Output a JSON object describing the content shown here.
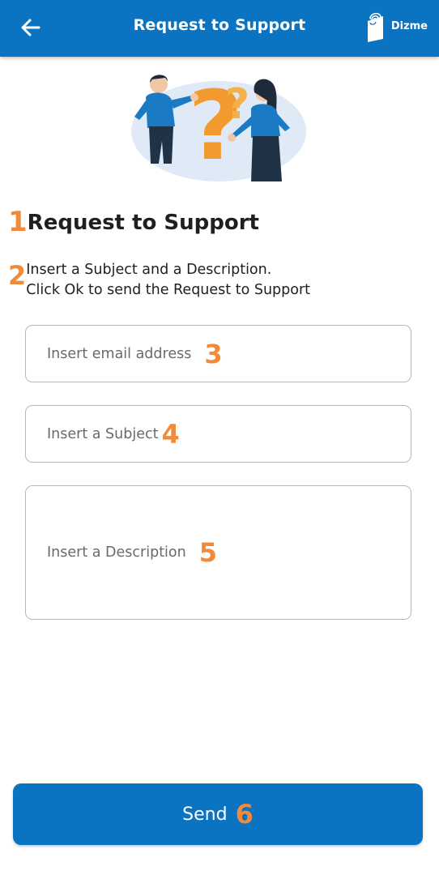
{
  "header": {
    "title": "Request to Support",
    "brand": "Dizme",
    "back_icon": "arrow-left-icon",
    "brand_icon": "fingerprint-card-icon",
    "color": "#0a74c2"
  },
  "annotations": {
    "n1": "1",
    "n2": "2",
    "n3": "3",
    "n4": "4",
    "n5": "5",
    "n6": "6",
    "color": "#f28a3a"
  },
  "content": {
    "title": "Request to Support",
    "instruction_line1": "Insert a Subject and a Description.",
    "instruction_line2": "Click Ok to send the Request to Support"
  },
  "form": {
    "email_placeholder": "Insert email address",
    "subject_placeholder": "Insert a Subject",
    "description_placeholder": "Insert a Description"
  },
  "actions": {
    "send_label": "Send"
  }
}
